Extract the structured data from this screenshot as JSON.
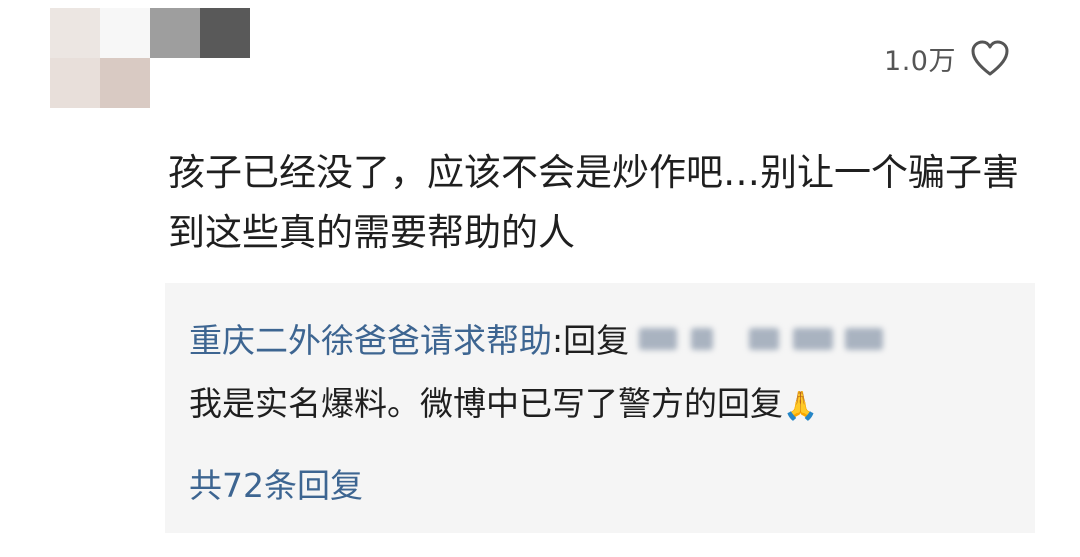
{
  "comment": {
    "avatar": {
      "mosaic_colors": [
        "#ece6e2",
        "#f7f7f7",
        "#9e9e9e",
        "#595959",
        "#e8dfda",
        "#d9cac3",
        "#ffffff",
        "#ffffff"
      ]
    },
    "like_count": "1.0万",
    "like_icon": "heart-outline-icon",
    "text": "孩子已经没了，应该不会是炒作吧…别让一个骗子害到这些真的需要帮助的人"
  },
  "reply_preview": {
    "author": "重庆二外徐爸爸请求帮助",
    "prefix": ":回复",
    "body": "我是实名爆料。微博中已写了警方的回复",
    "emoji": "🙏",
    "total_replies_label": "共72条回复"
  },
  "colors": {
    "link_blue": "#3d6591",
    "text_dark": "#1f1f1f",
    "reply_bg": "#f5f5f5",
    "meta_gray": "#555555"
  }
}
